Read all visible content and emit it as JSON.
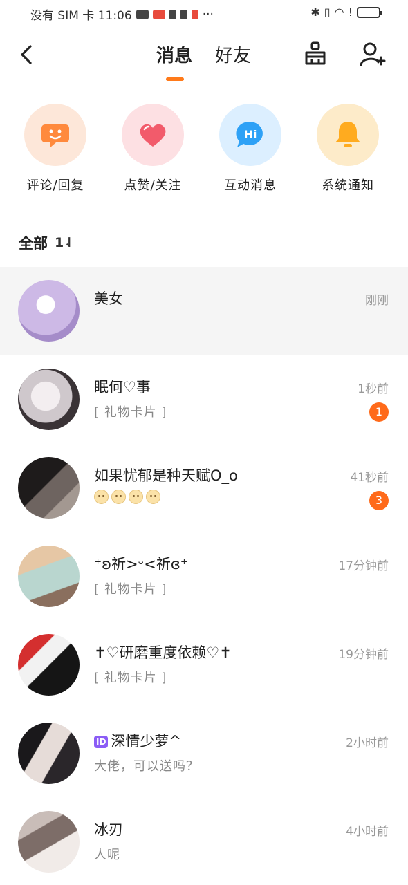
{
  "status_bar": {
    "left_text": "没有 SIM 卡 11:06",
    "more": "···"
  },
  "header": {
    "tabs": [
      {
        "label": "消息",
        "active": true
      },
      {
        "label": "好友",
        "active": false
      }
    ],
    "icons": [
      "back-icon",
      "broom-icon",
      "add-user-icon"
    ],
    "accent_color": "#ff7a1a"
  },
  "categories": [
    {
      "label": "评论/回复",
      "icon": "smile-chat-icon",
      "bg": "#fde7d9",
      "color": "#ff8a3d"
    },
    {
      "label": "点赞/关注",
      "icon": "heart-icon",
      "bg": "#fde0e3",
      "color": "#f25b6b"
    },
    {
      "label": "互动消息",
      "icon": "hi-bubble-icon",
      "bg": "#dcefff",
      "color": "#2ea1f6",
      "icon_text": "Hi"
    },
    {
      "label": "系统通知",
      "icon": "bell-icon",
      "bg": "#fdebc9",
      "color": "#ffab1f"
    }
  ],
  "section": {
    "title": "全部",
    "sort_label": "1⇃"
  },
  "messages": [
    {
      "name": "美女",
      "preview": "",
      "time": "刚刚",
      "badge": "",
      "highlight": true,
      "avatar_colors": [
        "#cdb9e6",
        "#b59ad8"
      ]
    },
    {
      "name": "眠何♡事",
      "preview": "[ 礼物卡片 ]",
      "time": "1秒前",
      "badge": "1",
      "highlight": false,
      "avatar_colors": [
        "#e9e6ea",
        "#5a5356"
      ]
    },
    {
      "name": "如果忧郁是种天赋O_o",
      "preview": "",
      "emoji_count": 4,
      "time": "41秒前",
      "badge": "3",
      "highlight": false,
      "avatar_colors": [
        "#3b3635",
        "#8a807a"
      ]
    },
    {
      "name": "⁺ʚ祈>ᵕ<祈ɞ⁺",
      "preview": "[ 礼物卡片 ]",
      "time": "17分钟前",
      "badge": "",
      "highlight": false,
      "avatar_colors": [
        "#d8b89a",
        "#9ec0b8"
      ]
    },
    {
      "name": "✝♡研磨重度依赖♡✝",
      "preview": "[ 礼物卡片 ]",
      "time": "19分钟前",
      "badge": "",
      "highlight": false,
      "avatar_colors": [
        "#cf2b2b",
        "#111111"
      ]
    },
    {
      "name": "深情少萝^",
      "id_tag": "ID",
      "preview": "大佬，可以送吗？",
      "time": "2小时前",
      "badge": "",
      "highlight": false,
      "avatar_colors": [
        "#dcd6d6",
        "#1c1a1d"
      ]
    },
    {
      "name": "冰刃",
      "preview": "人呢",
      "time": "4小时前",
      "badge": "",
      "highlight": false,
      "avatar_colors": [
        "#b9a9a4",
        "#e8e2df"
      ]
    }
  ]
}
